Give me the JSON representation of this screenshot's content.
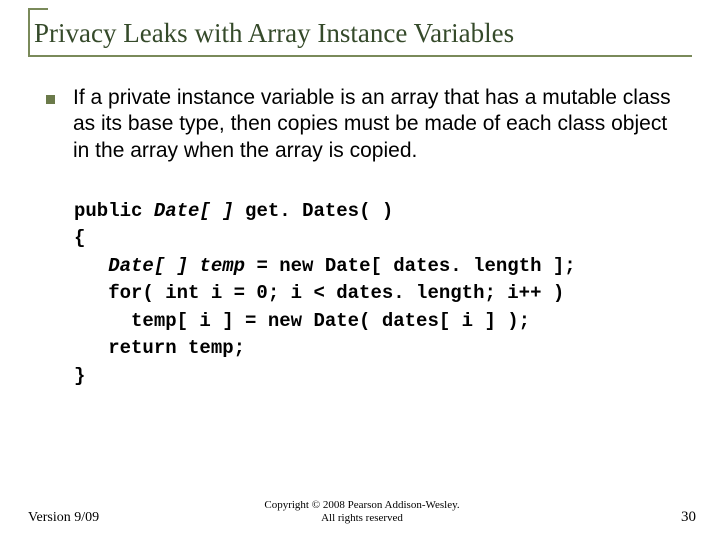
{
  "title": "Privacy Leaks with Array Instance Variables",
  "bullet_text": "If a private instance variable is an array that has a mutable class as its base type, then copies must be made of each class object in the array when the array is copied.",
  "code": {
    "l1a": "public ",
    "l1b": "Date[ ]",
    "l1c": " get. Dates( )",
    "l2": "{",
    "l3a": "   ",
    "l3b": "Date[ ] temp",
    "l3c": " = new Date[ dates. length ];",
    "l4": "   for( int i = 0; i < dates. length; i++ )",
    "l5": "     temp[ i ] = new Date( dates[ i ] );",
    "l6": "   return temp;",
    "l7": "}"
  },
  "footer": {
    "version": "Version 9/09",
    "copyright_line1": "Copyright © 2008 Pearson Addison-Wesley.",
    "copyright_line2": "All rights reserved",
    "page": "30"
  }
}
